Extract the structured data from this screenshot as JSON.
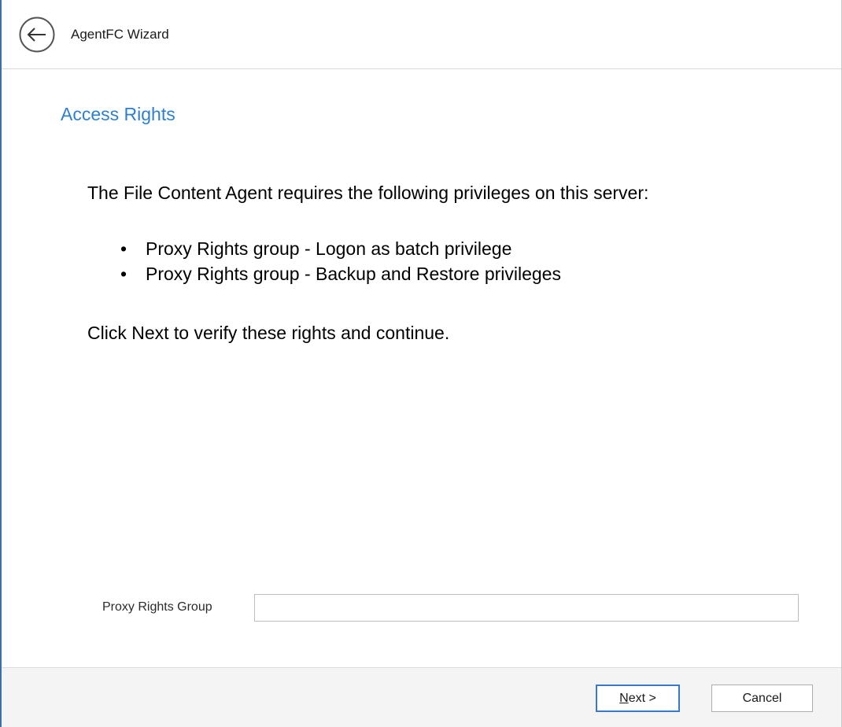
{
  "window": {
    "title": "AgentFC Wizard",
    "back_icon": "back-arrow-circle-icon"
  },
  "page": {
    "title": "Access Rights",
    "intro": "The File Content Agent requires the following privileges on this server:",
    "requirements": [
      "Proxy Rights group - Logon as batch privilege",
      "Proxy Rights group - Backup and Restore privileges"
    ],
    "bullet": "•",
    "outro": "Click Next to verify these rights and continue."
  },
  "form": {
    "proxy_group_label": "Proxy Rights Group",
    "proxy_group_value": ""
  },
  "footer": {
    "next_mnemonic": "N",
    "next_rest": "ext >",
    "cancel_label": "Cancel"
  },
  "colors": {
    "accent": "#2e7fcf",
    "default_button_border": "#3a78c8",
    "footer_bg": "#f4f4f4"
  }
}
